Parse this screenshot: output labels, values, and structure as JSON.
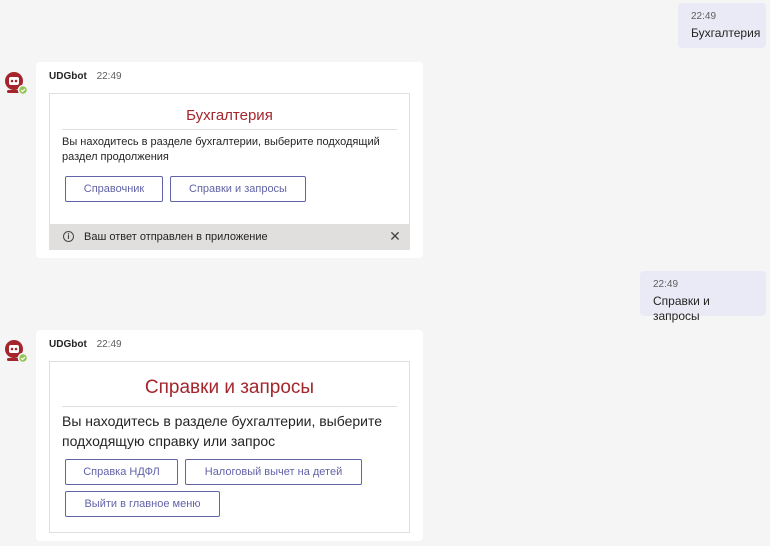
{
  "messages": {
    "user1": {
      "time": "22:49",
      "text": "Бухгалтерия"
    },
    "bot1": {
      "name": "UDGbot",
      "time": "22:49",
      "card": {
        "title": "Бухгалтерия",
        "text_line1": "Вы находитесь в разделе бухгалтерии, выберите подходящий",
        "text_line2": "раздел продолжения",
        "buttons": [
          "Справочник",
          "Справки и запросы"
        ],
        "notice": "Ваш ответ отправлен в приложение",
        "close_glyph": "✕",
        "info_glyph": "i"
      }
    },
    "user2": {
      "time": "22:49",
      "text": "Справки и запросы"
    },
    "bot2": {
      "name": "UDGbot",
      "time": "22:49",
      "card": {
        "title": "Справки и запросы",
        "text_line1": "Вы находитесь в разделе бухгалтерии, выберите",
        "text_line2": "подходящую справку или запрос",
        "buttons": [
          "Справка НДФЛ",
          "Налоговый вычет на детей",
          "Выйти в главное меню"
        ]
      }
    }
  },
  "colors": {
    "accent": "#6264a7",
    "title": "#a4262c",
    "user_bubble": "#e9eaf6",
    "presence": "#92c353"
  },
  "icons": {
    "avatar": "robot-avatar-icon",
    "presence": "presence-available-icon",
    "info": "info-icon",
    "close": "close-icon"
  }
}
